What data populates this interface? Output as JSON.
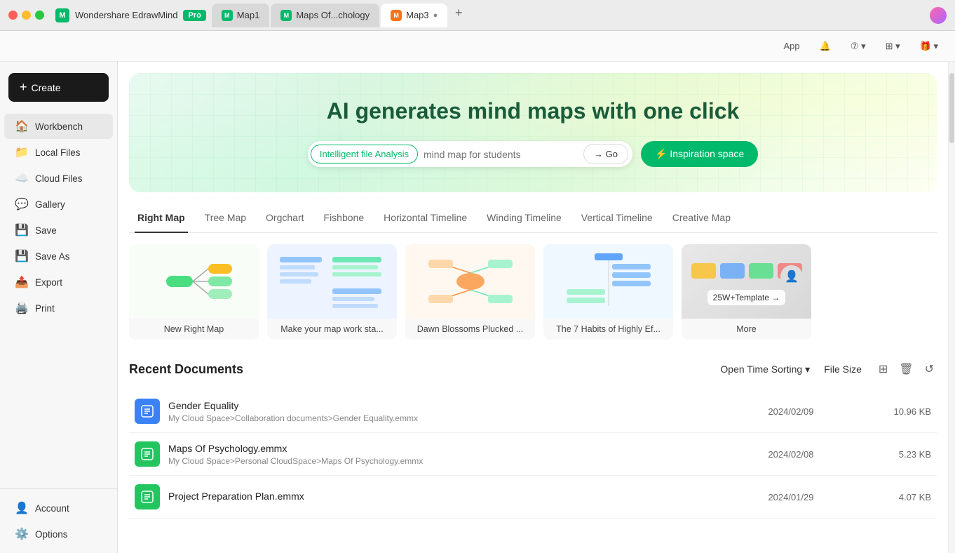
{
  "titlebar": {
    "app_name": "Wondershare EdrawMind",
    "badge": "Pro",
    "tabs": [
      {
        "label": "Map1",
        "active": false
      },
      {
        "label": "Maps Of...chology",
        "active": false
      },
      {
        "label": "Map3",
        "active": true,
        "unsaved": true
      }
    ]
  },
  "toolbar": {
    "app_label": "App",
    "bell_label": "🔔",
    "help_label": "⑦",
    "grid_label": "⊞",
    "gift_label": "🎁"
  },
  "sidebar": {
    "create_label": "Create",
    "items": [
      {
        "id": "workbench",
        "label": "Workbench",
        "icon": "🏠",
        "active": true
      },
      {
        "id": "local-files",
        "label": "Local Files",
        "icon": "📁"
      },
      {
        "id": "cloud-files",
        "label": "Cloud Files",
        "icon": "☁️"
      },
      {
        "id": "gallery",
        "label": "Gallery",
        "icon": "💬"
      },
      {
        "id": "save",
        "label": "Save",
        "icon": "💾"
      },
      {
        "id": "save-as",
        "label": "Save As",
        "icon": "💾"
      },
      {
        "id": "export",
        "label": "Export",
        "icon": "📤"
      },
      {
        "id": "print",
        "label": "Print",
        "icon": "🖨️"
      }
    ],
    "bottom_items": [
      {
        "id": "account",
        "label": "Account",
        "icon": "👤"
      },
      {
        "id": "options",
        "label": "Options",
        "icon": "⚙️"
      }
    ]
  },
  "hero": {
    "title": "AI generates mind maps with one click",
    "badge_label": "Intelligent file Analysis",
    "input_placeholder": "mind map for students",
    "go_label": "→ Go",
    "inspiration_label": "⚡ Inspiration space"
  },
  "map_section": {
    "tabs": [
      {
        "label": "Right Map",
        "active": true
      },
      {
        "label": "Tree Map",
        "active": false
      },
      {
        "label": "Orgchart",
        "active": false
      },
      {
        "label": "Fishbone",
        "active": false
      },
      {
        "label": "Horizontal Timeline",
        "active": false
      },
      {
        "label": "Winding Timeline",
        "active": false
      },
      {
        "label": "Vertical Timeline",
        "active": false
      },
      {
        "label": "Creative Map",
        "active": false
      }
    ],
    "cards": [
      {
        "label": "New Right Map",
        "type": "new"
      },
      {
        "label": "Make your map work sta...",
        "type": "template-blue"
      },
      {
        "label": "Dawn Blossoms Plucked ...",
        "type": "template-orange"
      },
      {
        "label": "The 7 Habits of Highly Ef...",
        "type": "template-vertical"
      }
    ],
    "more_label": "More",
    "template_badge": "25W+Template →"
  },
  "recent": {
    "title": "Recent Documents",
    "sort_label": "Open Time Sorting",
    "sort_icon": "▾",
    "file_size_label": "File Size",
    "documents": [
      {
        "name": "Gender Equality",
        "path": "My Cloud Space>Collaboration documents>Gender Equality.emmx",
        "date": "2024/02/09",
        "size": "10.96 KB",
        "icon_color": "blue",
        "icon": "🗺️"
      },
      {
        "name": "Maps Of Psychology.emmx",
        "path": "My Cloud Space>Personal CloudSpace>Maps Of Psychology.emmx",
        "date": "2024/02/08",
        "size": "5.23 KB",
        "icon_color": "green",
        "icon": "🗺️"
      },
      {
        "name": "Project Preparation Plan.emmx",
        "path": "",
        "date": "2024/01/29",
        "size": "4.07 KB",
        "icon_color": "green",
        "icon": "🗺️"
      }
    ]
  }
}
